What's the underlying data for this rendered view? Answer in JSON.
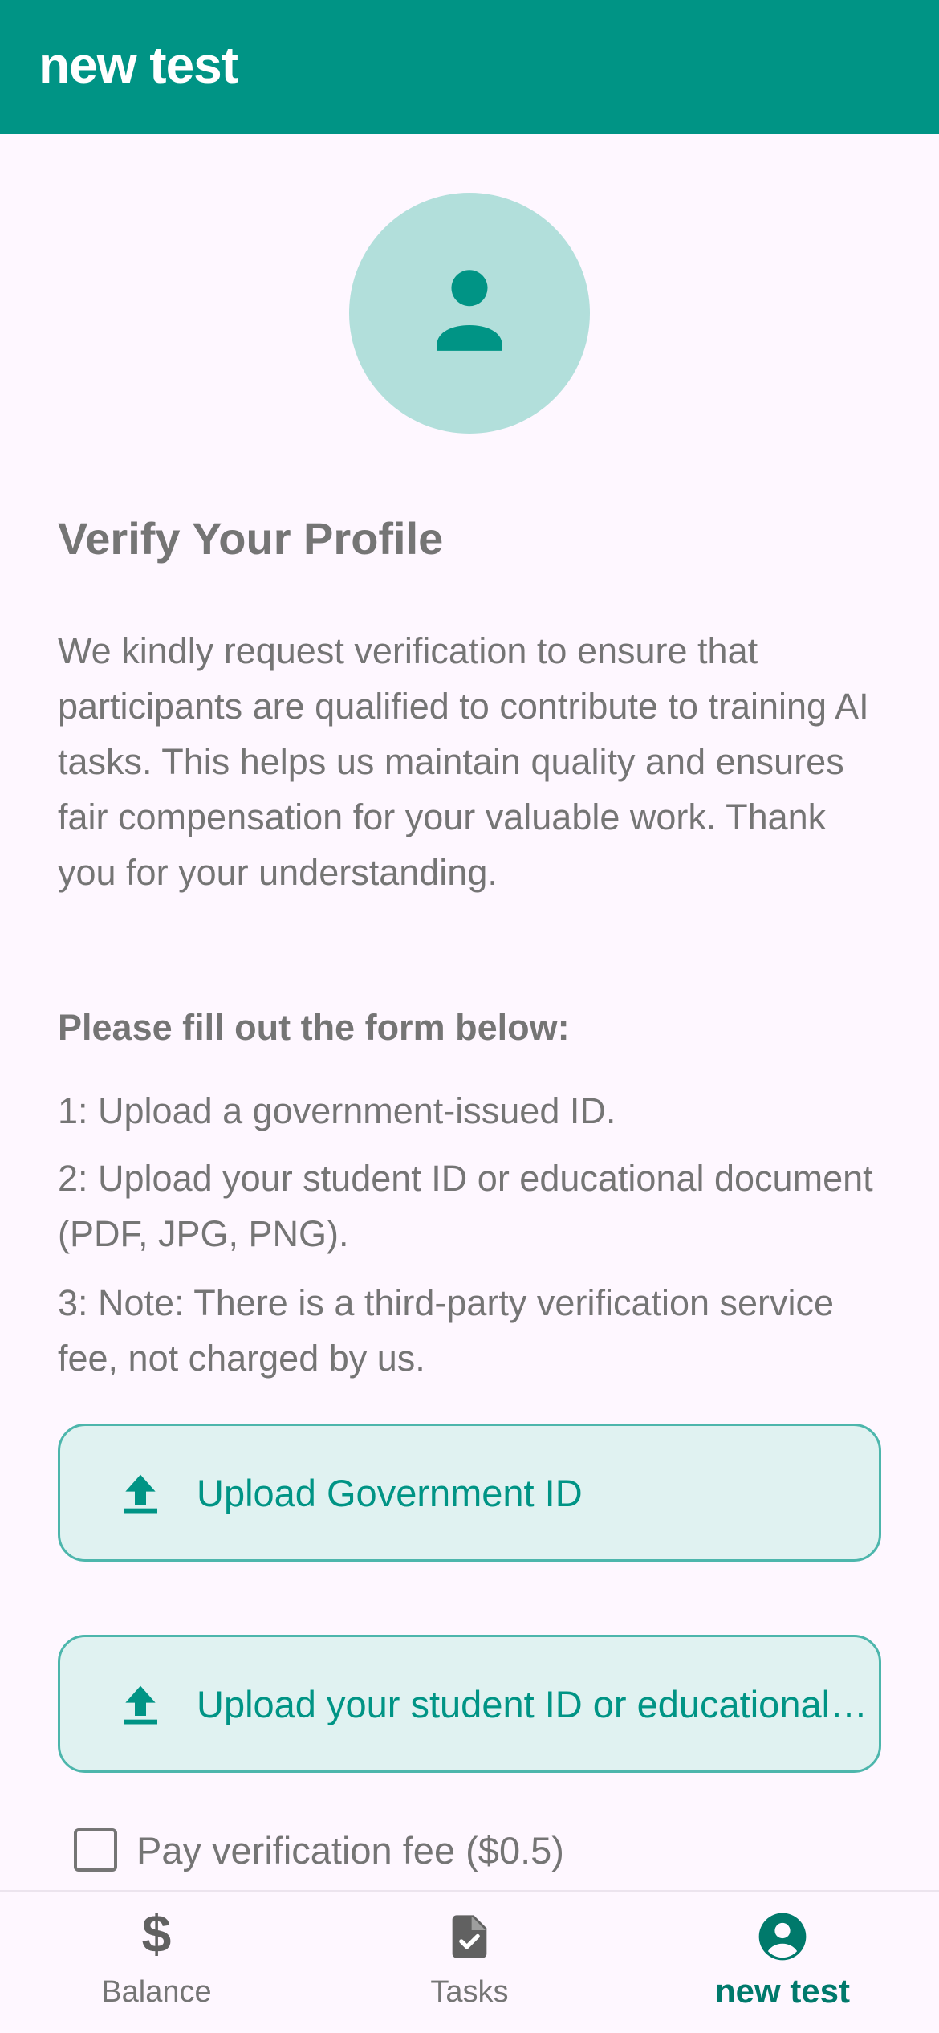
{
  "app_bar": {
    "title": "new test"
  },
  "avatar": {
    "icon": "person-icon",
    "bg_color": "#B2DFDB",
    "icon_color": "#009485"
  },
  "content": {
    "title": "Verify Your Profile",
    "description": "We kindly request verification to ensure that participants are qualified to contribute to training AI tasks. This helps us maintain quality and ensures fair compensation for your valuable work. Thank you for your understanding.",
    "form_heading": "Please fill out the form below:",
    "steps": [
      "1: Upload a government-issued ID.",
      "2: Upload your student ID or educational document (PDF, JPG, PNG).",
      "3: Note: There is a third-party verification service fee, not charged by us."
    ]
  },
  "buttons": {
    "upload_gov_id": "Upload Government ID",
    "upload_student_id": "Upload your student ID or educational document"
  },
  "fee": {
    "label": "Pay verification fee ($0.5)",
    "checked": false
  },
  "bottom_nav": {
    "items": [
      {
        "label": "Balance",
        "icon": "dollar-icon"
      },
      {
        "label": "Tasks",
        "icon": "task-document-icon"
      },
      {
        "label": "new test",
        "icon": "account-circle-icon",
        "selected": true
      }
    ]
  },
  "colors": {
    "primary": "#009485",
    "background": "#FEF7FF",
    "text_muted": "#757575"
  }
}
